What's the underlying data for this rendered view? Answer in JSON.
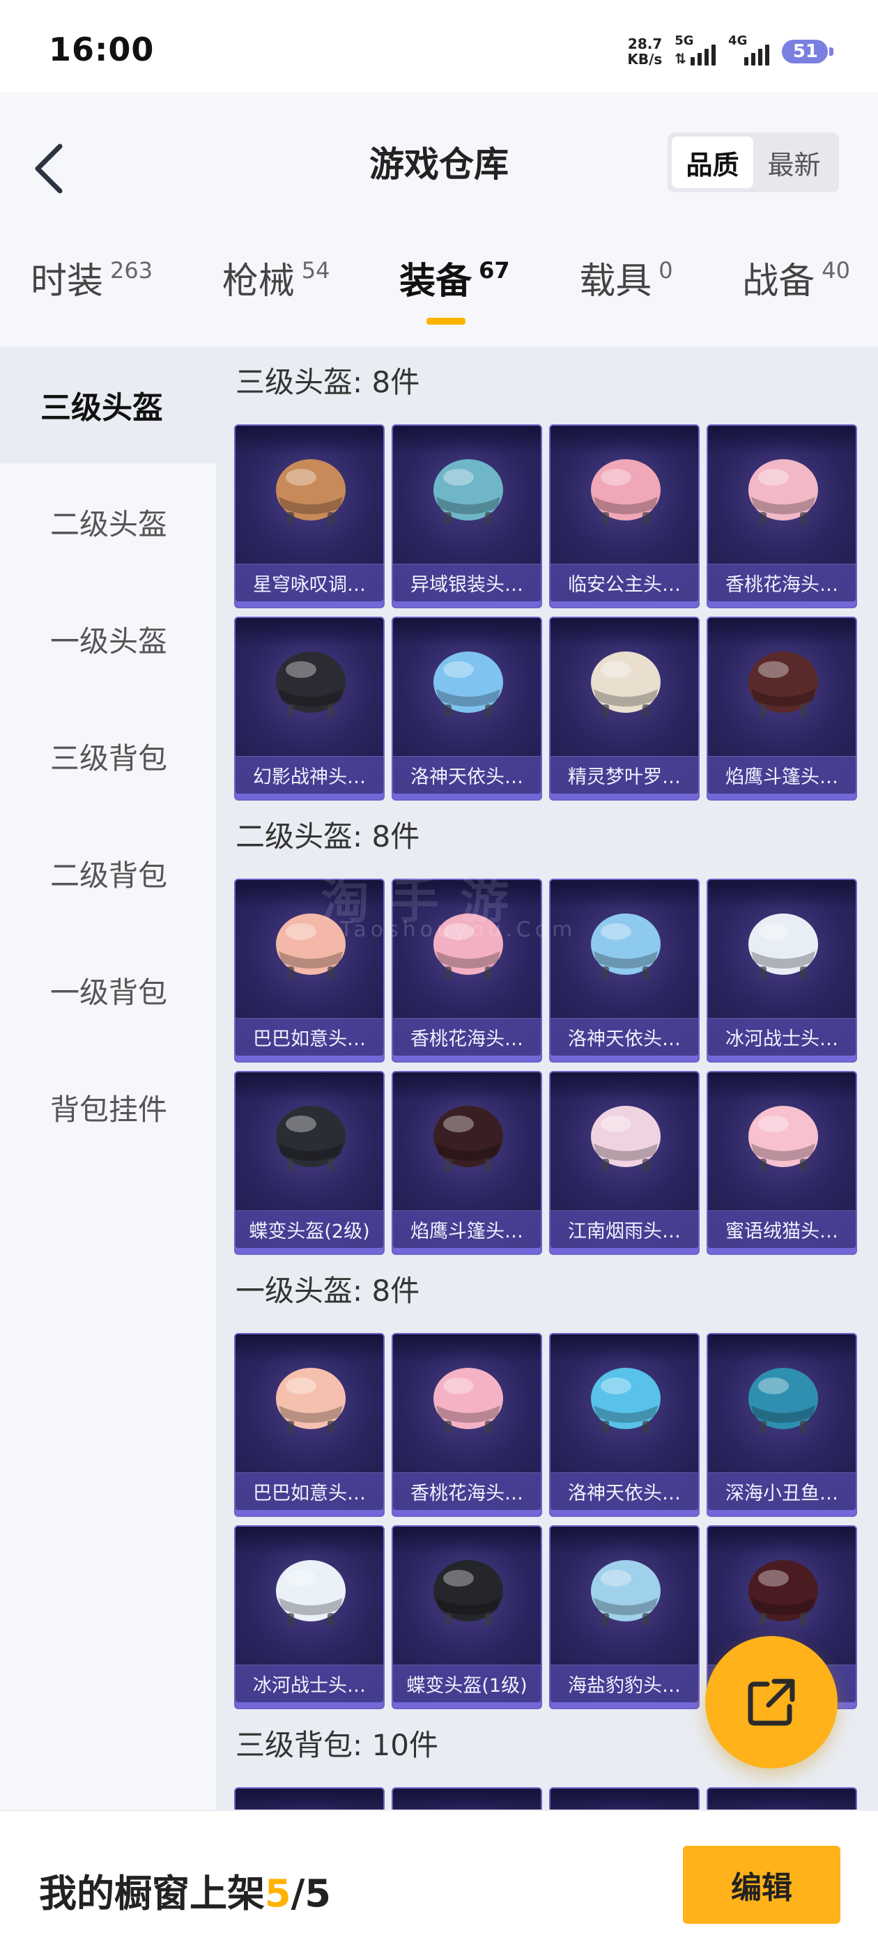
{
  "status_bar": {
    "time": "16:00",
    "net_speed_value": "28.7",
    "net_speed_unit": "KB/s",
    "signal1_label": "5G",
    "signal2_label": "4G",
    "battery": "51"
  },
  "header": {
    "title": "游戏仓库",
    "sort_options": [
      "品质",
      "最新"
    ]
  },
  "tabs": [
    {
      "name": "时装",
      "count": "263"
    },
    {
      "name": "枪械",
      "count": "54"
    },
    {
      "name": "装备",
      "count": "67"
    },
    {
      "name": "载具",
      "count": "0"
    },
    {
      "name": "战备",
      "count": "40"
    }
  ],
  "sidebar": [
    "三级头盔",
    "二级头盔",
    "一级头盔",
    "三级背包",
    "二级背包",
    "一级背包",
    "背包挂件"
  ],
  "sections": [
    {
      "title": "三级头盔: 8件",
      "items": [
        {
          "name": "星穹咏叹调…",
          "color": "#c98a5a"
        },
        {
          "name": "异域银装头…",
          "color": "#6fb6c8"
        },
        {
          "name": "临安公主头…",
          "color": "#f0a7b8"
        },
        {
          "name": "香桃花海头…",
          "color": "#f3b8c6"
        },
        {
          "name": "幻影战神头…",
          "color": "#2b2b33"
        },
        {
          "name": "洛神天依头…",
          "color": "#7fc3f0"
        },
        {
          "name": "精灵梦叶罗…",
          "color": "#eadfcf"
        },
        {
          "name": "焰鹰斗篷头…",
          "color": "#5a2a2a"
        }
      ]
    },
    {
      "title": "二级头盔: 8件",
      "items": [
        {
          "name": "巴巴如意头…",
          "color": "#f4b8a8"
        },
        {
          "name": "香桃花海头…",
          "color": "#f2b0c2"
        },
        {
          "name": "洛神天依头…",
          "color": "#8ec9ee"
        },
        {
          "name": "冰河战士头…",
          "color": "#e8eef6"
        },
        {
          "name": "蝶变头盔(2级)",
          "color": "#2a2d33"
        },
        {
          "name": "焰鹰斗篷头…",
          "color": "#3a1f22"
        },
        {
          "name": "江南烟雨头…",
          "color": "#f0d3e0"
        },
        {
          "name": "蜜语绒猫头…",
          "color": "#f7c1cf"
        }
      ]
    },
    {
      "title": "一级头盔: 8件",
      "items": [
        {
          "name": "巴巴如意头…",
          "color": "#f6c0ae"
        },
        {
          "name": "香桃花海头…",
          "color": "#f4b2c4"
        },
        {
          "name": "洛神天依头…",
          "color": "#58c2ea"
        },
        {
          "name": "深海小丑鱼…",
          "color": "#2f8fb0"
        },
        {
          "name": "冰河战士头…",
          "color": "#eaf1f8"
        },
        {
          "name": "蝶变头盔(1级)",
          "color": "#24262b"
        },
        {
          "name": "海盐豹豹头…",
          "color": "#9fd0ec"
        },
        {
          "name": "",
          "color": "#4a1c22"
        }
      ]
    },
    {
      "title": "三级背包: 10件",
      "items": []
    }
  ],
  "watermark": {
    "main": "淘手游",
    "sub": "Taoshouyou.Com"
  },
  "bottom_bar": {
    "label": "我的橱窗上架",
    "current": "5",
    "separator": "/",
    "total": "5",
    "edit_label": "编辑"
  },
  "icons": {
    "back": "chevron-left-icon",
    "share": "share-icon"
  }
}
